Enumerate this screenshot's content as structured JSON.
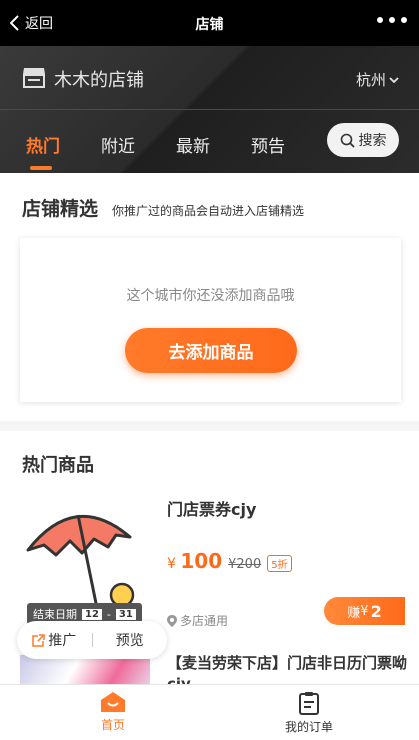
{
  "nav": {
    "back_label": "返回",
    "title": "店铺"
  },
  "store": {
    "name": "木木的店铺",
    "city": "杭州"
  },
  "tabs": [
    {
      "label": "热门",
      "active": true
    },
    {
      "label": "附近",
      "active": false
    },
    {
      "label": "最新",
      "active": false
    },
    {
      "label": "预告",
      "active": false
    }
  ],
  "search": {
    "label": "搜索"
  },
  "featured": {
    "title": "店铺精选",
    "subtitle": "你推广过的商品会自动进入店铺精选",
    "empty_text": "这个城市你还没添加商品哦",
    "add_button": "去添加商品"
  },
  "hot": {
    "title": "热门商品",
    "products": [
      {
        "name": "门店票券cjy",
        "currency": "¥",
        "price": "100",
        "old_price": "¥200",
        "discount": "5折",
        "end_label": "结束日期",
        "end_month": "12",
        "end_sep": "-",
        "end_day": "31",
        "location": "多店通用",
        "earn_label": "赚",
        "earn_currency": "¥",
        "earn_value": "2"
      },
      {
        "name": "【麦当劳荣下店】门店非日历门票呦cjy"
      }
    ],
    "share_label": "推广",
    "preview_label": "预览"
  },
  "tabbar": {
    "home": "首页",
    "orders": "我的订单"
  },
  "colors": {
    "accent": "#ff7a2a",
    "dark": "#000000"
  }
}
